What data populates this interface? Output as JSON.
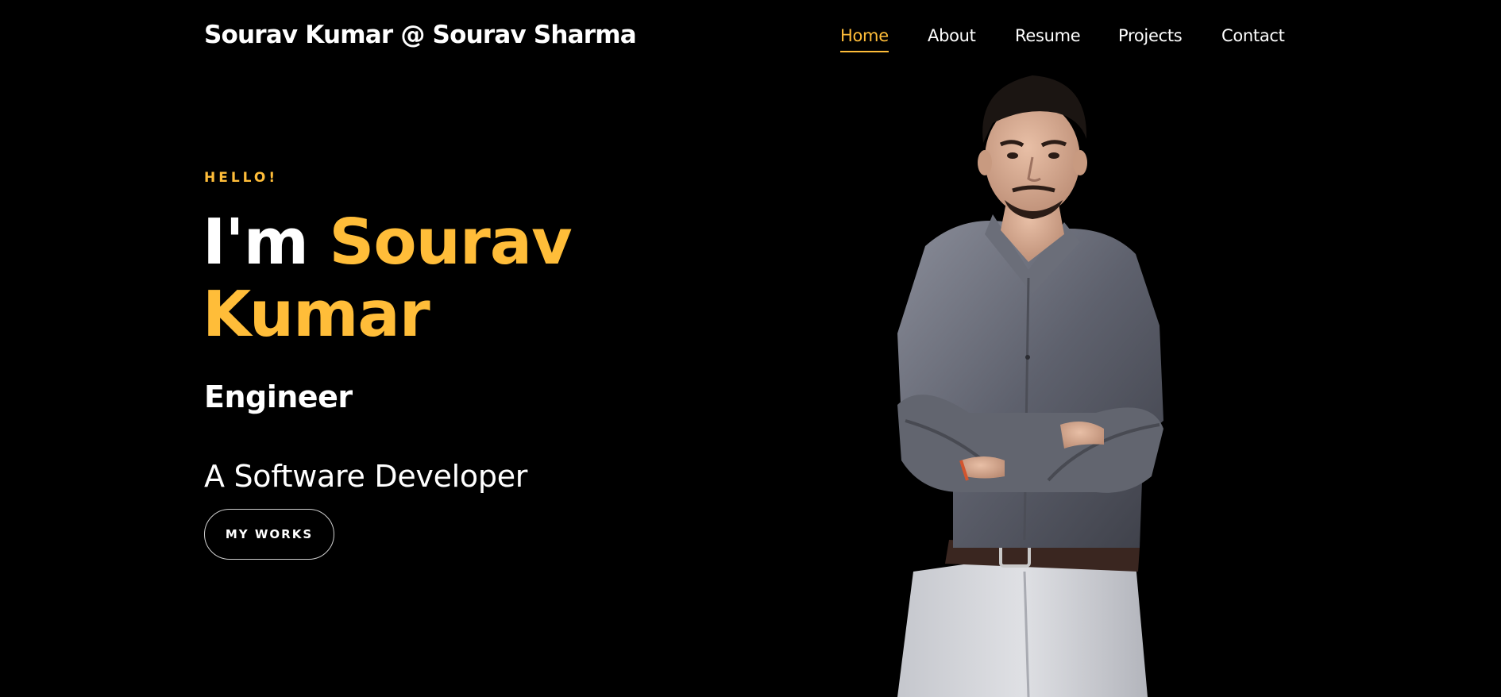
{
  "header": {
    "brand": "Sourav Kumar @ Sourav Sharma",
    "nav": [
      {
        "label": "Home",
        "active": true
      },
      {
        "label": "About",
        "active": false
      },
      {
        "label": "Resume",
        "active": false
      },
      {
        "label": "Projects",
        "active": false
      },
      {
        "label": "Contact",
        "active": false
      }
    ]
  },
  "hero": {
    "greeting": "HELLO!",
    "intro": "I'm",
    "first_name": "Sourav",
    "last_name": "Kumar",
    "role": "Engineer",
    "tagline": "A Software Developer",
    "cta_label": "MY WORKS"
  },
  "colors": {
    "background": "#000000",
    "accent": "#ffbd39",
    "text": "#ffffff"
  }
}
